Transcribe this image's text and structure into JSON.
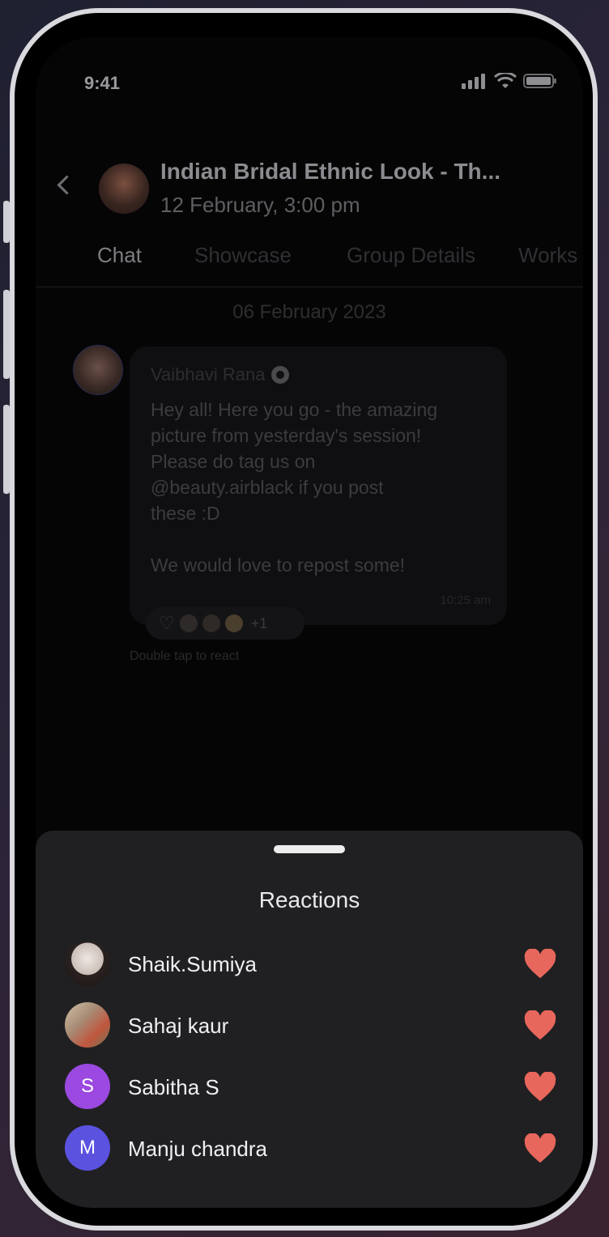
{
  "status_bar": {
    "time": "9:41"
  },
  "header": {
    "title": "Indian Bridal Ethnic Look - Th...",
    "subtitle": "12 February, 3:00 pm"
  },
  "tabs": [
    {
      "label": "Chat",
      "active": true
    },
    {
      "label": "Showcase",
      "active": false
    },
    {
      "label": "Group Details",
      "active": false
    },
    {
      "label": "Works",
      "active": false
    }
  ],
  "chat": {
    "date_separator": "06 February 2023",
    "message": {
      "sender": "Vaibhavi Rana",
      "text_lines": [
        "Hey all! Here you go - the amazing",
        "picture from yesterday's session!",
        "Please do tag us on",
        "@beauty.airblack if you post",
        "these :D"
      ],
      "text_last": "We would love to repost some!",
      "time": "10:25 am",
      "reaction_count": "+1"
    },
    "hint": "Double tap to react"
  },
  "reactions_sheet": {
    "title": "Reactions",
    "reactions_icon": "heart-icon",
    "heart_color": "#e8675c",
    "users": [
      {
        "name": "Shaik.Sumiya",
        "initial": "",
        "avatar_color": "#d7cfca"
      },
      {
        "name": "Sahaj kaur",
        "initial": "",
        "avatar_color": "#b59a86"
      },
      {
        "name": "Sabitha S",
        "initial": "S",
        "avatar_color": "#9b49e0"
      },
      {
        "name": "Manju chandra",
        "initial": "M",
        "avatar_color": "#5b52e0"
      }
    ]
  }
}
